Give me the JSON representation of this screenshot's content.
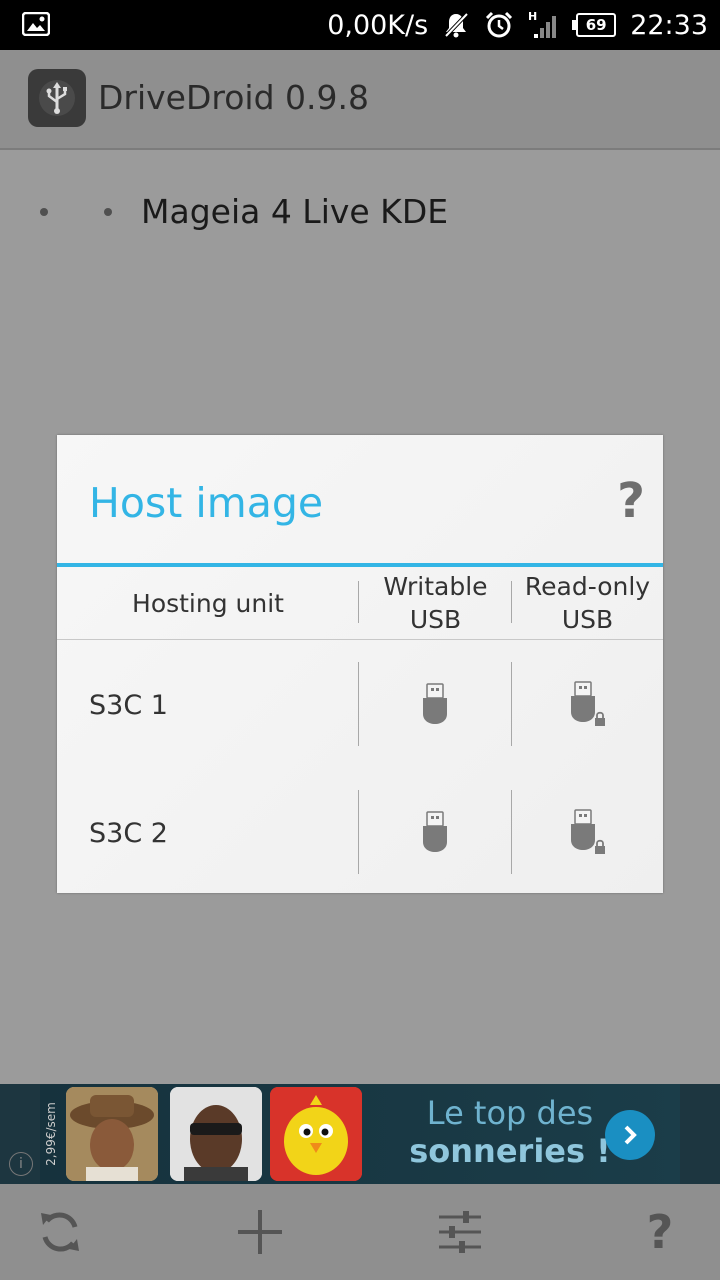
{
  "status_bar": {
    "net_speed": "0,00K/s",
    "network_type": "H",
    "battery": "69",
    "time": "22:33",
    "icons": [
      "image-notification-icon",
      "bell-muted-icon",
      "alarm-icon",
      "signal-icon",
      "battery-icon"
    ]
  },
  "app": {
    "title": "DriveDroid 0.9.8",
    "icon": "usb-icon"
  },
  "list": {
    "items": [
      {
        "label": "Mageia 4  Live KDE"
      }
    ]
  },
  "dialog": {
    "title": "Host image",
    "help": "?",
    "columns": {
      "unit": "Hosting unit",
      "writable_line1": "Writable",
      "writable_line2": "USB",
      "readonly_line1": "Read-only",
      "readonly_line2": "USB"
    },
    "rows": [
      {
        "label": "S3C 1",
        "writable_icon": "usb-drive-icon",
        "readonly_icon": "usb-drive-locked-icon"
      },
      {
        "label": "S3C 2",
        "writable_icon": "usb-drive-icon",
        "readonly_icon": "usb-drive-locked-icon"
      }
    ],
    "accent_color": "#33b5e5"
  },
  "ad": {
    "price": "2,99€/sem",
    "line1": "Le top des",
    "line2": "sonneries !",
    "info": "i"
  },
  "bottom_bar": {
    "help": "?",
    "buttons": [
      "refresh-icon",
      "add-icon",
      "settings-sliders-icon",
      "help-icon"
    ]
  }
}
